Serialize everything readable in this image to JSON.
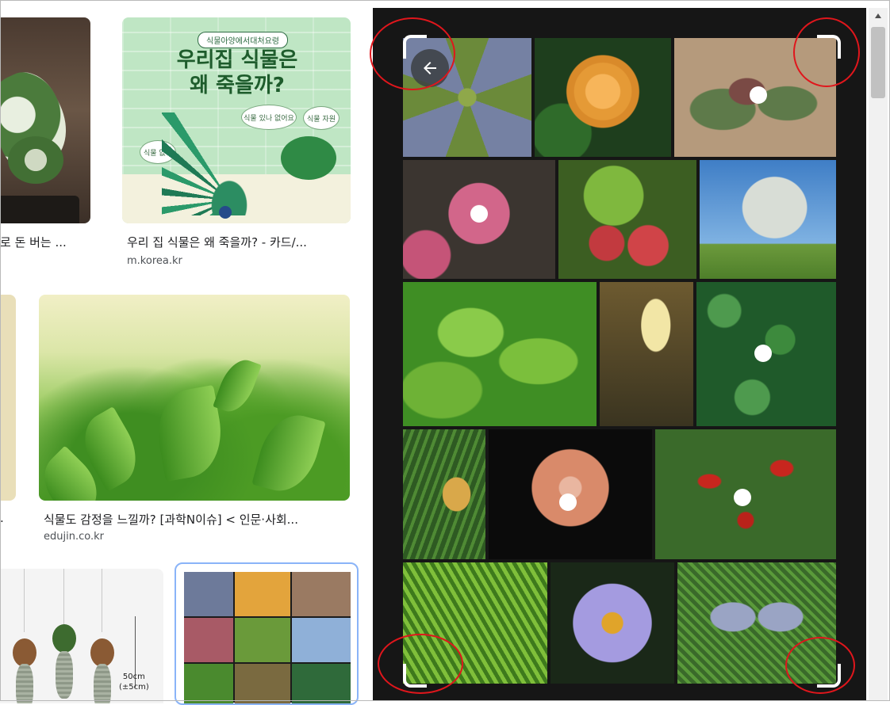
{
  "results": [
    {
      "caption": "로 돈 버는 ...",
      "domain": ""
    },
    {
      "caption": "우리 집 식물은 왜 죽을까? - 카드/...",
      "domain": "m.korea.kr",
      "poster": {
        "tag": "식물아양에서대처요령",
        "headline": "우리집 식물은\n왜 죽을까?",
        "bubbles": [
          "식물 없니",
          "식물 있나 없어요",
          "식물 자원"
        ]
      }
    },
    {
      "caption": ".",
      "domain": ""
    },
    {
      "caption": "식물도 감정을 느낄까? [과학N이슈] < 인문·사회...",
      "domain": "edujin.co.kr"
    },
    {
      "size_label": "50cm\n(±5cm)"
    }
  ],
  "viewer": {
    "back_icon": "arrow-left-icon",
    "annotation_color": "#e0161c"
  },
  "scrollbar": {
    "up_icon": "triangle-up-icon"
  }
}
